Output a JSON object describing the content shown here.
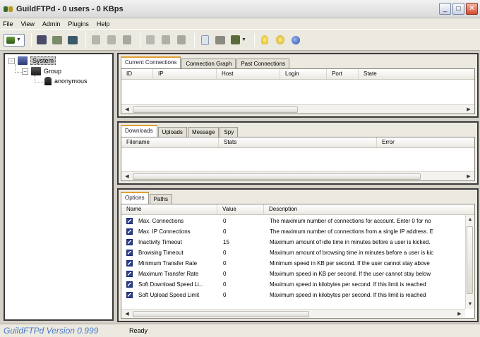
{
  "window": {
    "title": "GuildFTPd - 0 users - 0 KBps",
    "minimize": "_",
    "maximize": "□",
    "close": "✕"
  },
  "menu": [
    "File",
    "View",
    "Admin",
    "Plugins",
    "Help"
  ],
  "toolbar": {
    "icons": [
      "connect-icon",
      "users-icon",
      "group-icon",
      "monitor-icon",
      "copy-icon",
      "paste-icon",
      "delete-icon",
      "page-icon",
      "page2-icon",
      "page3-icon",
      "document-icon",
      "settings-icon",
      "plugin-icon",
      "lightbulb-icon",
      "tip-icon",
      "globe-icon"
    ]
  },
  "tree": {
    "root": "System",
    "group": "Group",
    "user": "anonymous"
  },
  "connections": {
    "tabs": [
      "Current Connections",
      "Connection Graph",
      "Past Connections"
    ],
    "columns": [
      "ID",
      "IP",
      "Host",
      "Login",
      "Port",
      "State"
    ]
  },
  "transfers": {
    "tabs": [
      "Downloads",
      "Uploads",
      "Message",
      "Spy"
    ],
    "columns": [
      "Filename",
      "Stats",
      "Error"
    ]
  },
  "options": {
    "tabs": [
      "Options",
      "Paths"
    ],
    "columns": [
      "Name",
      "Value",
      "Description"
    ],
    "rows": [
      {
        "name": "Max. Connections",
        "value": "0",
        "description": "The maximum number of connections for account.  Enter 0 for no"
      },
      {
        "name": "Max. IP Connections",
        "value": "0",
        "description": "The maximum number of connections from a single IP address.  E"
      },
      {
        "name": "Inactivity Timeout",
        "value": "15",
        "description": "Maximum amount of idle time in minutes before a user is kicked."
      },
      {
        "name": "Browsing Timeout",
        "value": "0",
        "description": "Maximum amount of browsing time in minutes before a user is kic"
      },
      {
        "name": "Minimum Transfer Rate",
        "value": "0",
        "description": "Minimum speed in KB per second.  If the user cannot stay above"
      },
      {
        "name": "Maximum Transfer Rate",
        "value": "0",
        "description": "Maximum speed in KB per second.  If the user cannot stay below"
      },
      {
        "name": "Soft Download Speed Li...",
        "value": "0",
        "description": "Maximum speed in kilobytes per second.  If this limit is reached"
      },
      {
        "name": "Soft Upload Speed Limit",
        "value": "0",
        "description": "Maximum speed in kilobytes per second.  If this limit is reached"
      }
    ]
  },
  "status": {
    "brand": "GuildFTPd Version 0.999",
    "text": "Ready"
  },
  "colors": {
    "accent": "#e0a030",
    "brand": "#4a7ac8",
    "checkbox": "#2a3f9a"
  }
}
